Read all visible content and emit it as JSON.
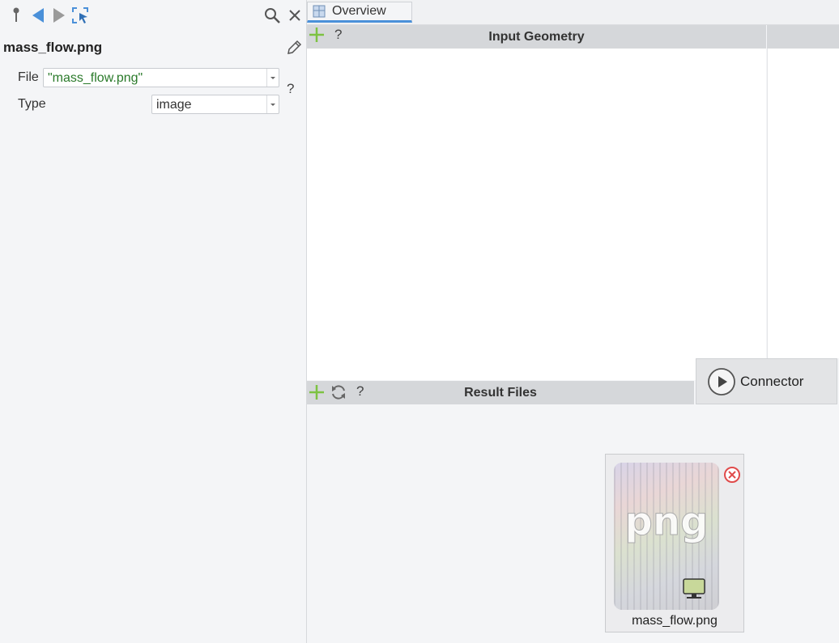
{
  "left_panel": {
    "title": "mass_flow.png",
    "fields": {
      "file": {
        "label": "File",
        "value": "\"mass_flow.png\""
      },
      "type": {
        "label": "Type",
        "value": "image"
      }
    },
    "help_label": "?"
  },
  "tabs": [
    {
      "label": "Overview"
    }
  ],
  "sections": {
    "input_geometry": {
      "title": "Input Geometry",
      "help_label": "?"
    },
    "result_files": {
      "title": "Result Files",
      "help_label": "?"
    }
  },
  "connector": {
    "label": "Connector"
  },
  "file_card": {
    "name": "mass_flow.png",
    "thumb_text": "png"
  },
  "colors": {
    "accent": "#4a90d9",
    "add_green": "#7dc242",
    "remove_red": "#e04b4b",
    "file_value_green": "#2a7a2a"
  }
}
